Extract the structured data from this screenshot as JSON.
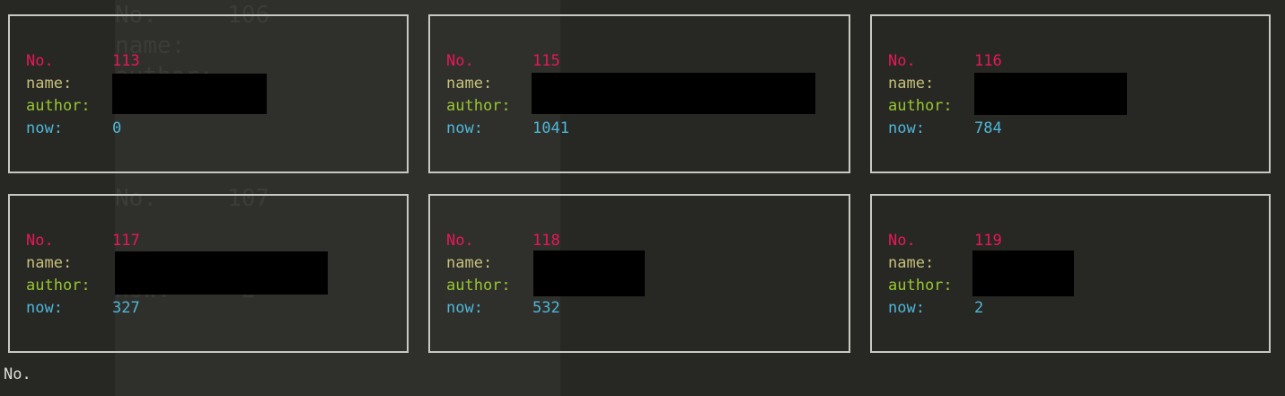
{
  "terminal": {
    "prompt_text": "No.",
    "labels": {
      "no": "No.",
      "name": "name:",
      "author": "author:",
      "now": "now:"
    },
    "background_ghost": {
      "line1": "No.     106",
      "line2": "name:",
      "line3": "author:",
      "line4": "No.     107",
      "line5": "now:     2"
    },
    "cards": [
      {
        "no": "113",
        "name": "",
        "author": "",
        "now": "0"
      },
      {
        "no": "115",
        "name": "",
        "author": "",
        "now": "1041"
      },
      {
        "no": "116",
        "name": "",
        "author": "",
        "now": "784"
      },
      {
        "no": "117",
        "name": "",
        "author": "",
        "now": "327"
      },
      {
        "no": "118",
        "name": "",
        "author": "",
        "now": "532"
      },
      {
        "no": "119",
        "name": "",
        "author": "",
        "now": "2"
      }
    ]
  },
  "colors": {
    "no": "#e8175a",
    "name": "#c6c07a",
    "author": "#98c531",
    "now": "#4fb6d8",
    "border": "#c9c9c4",
    "background": "#272824"
  }
}
